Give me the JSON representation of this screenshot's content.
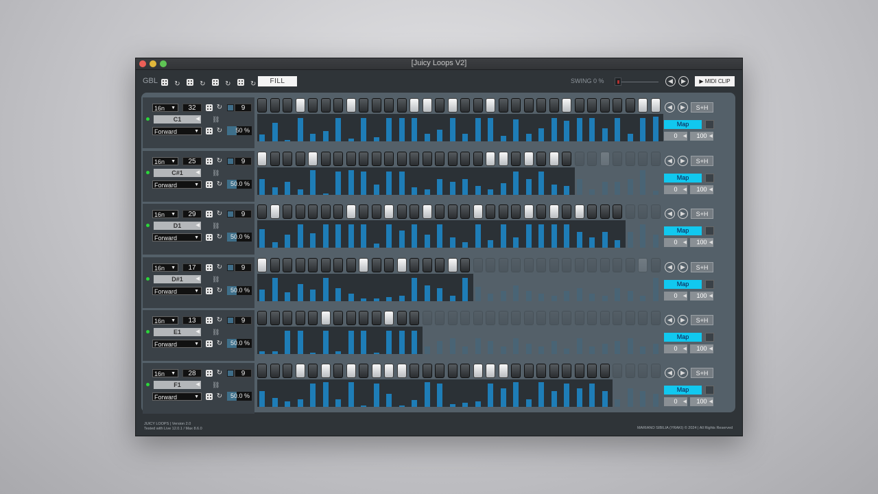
{
  "window": {
    "title": "[Juicy Loops V2]"
  },
  "toolbar": {
    "gbl_label": "GBL",
    "fill_label": "FILL",
    "swing_label": "SWING 0 %",
    "swing_value": 0,
    "midi_clip_label": "MIDI CLIP",
    "prev_icon": "arrow-left-circle-icon",
    "next_icon": "arrow-right-circle-icon"
  },
  "colors": {
    "accent": "#11c8ef",
    "velocity_bar": "#1e7db7",
    "step_on": "#f2f2f2",
    "status_dot": "#2bd63a"
  },
  "tracks": [
    {
      "rate": "16n",
      "length": "32",
      "amount": "9",
      "note": "C1",
      "direction": "Forward",
      "probability": "50 %",
      "steps": [
        0,
        0,
        0,
        1,
        0,
        0,
        0,
        1,
        0,
        0,
        0,
        0,
        1,
        1,
        0,
        1,
        0,
        0,
        1,
        0,
        0,
        0,
        0,
        0,
        1,
        0,
        0,
        0,
        0,
        0,
        1,
        1
      ],
      "velocity": [
        0.25,
        0.7,
        0.05,
        0.9,
        0.3,
        0.4,
        0.9,
        0.1,
        0.9,
        0.15,
        0.9,
        0.9,
        0.9,
        0.3,
        0.45,
        0.9,
        0.3,
        0.9,
        0.9,
        0.2,
        0.85,
        0.3,
        0.5,
        0.9,
        0.8,
        0.9,
        0.9,
        0.5,
        0.9,
        0.3,
        0.9,
        0.95
      ],
      "sh_label": "S+H",
      "map_label": "Map",
      "range_min": "0",
      "range_max": "100"
    },
    {
      "rate": "16n",
      "length": "25",
      "amount": "9",
      "note": "C#1",
      "direction": "Forward",
      "probability": "50.0 %",
      "steps": [
        1,
        0,
        0,
        0,
        1,
        0,
        0,
        0,
        0,
        0,
        0,
        0,
        0,
        0,
        0,
        0,
        0,
        0,
        1,
        1,
        0,
        1,
        0,
        1,
        0,
        0,
        0,
        1,
        0,
        0,
        0,
        0
      ],
      "velocity": [
        0.6,
        0.3,
        0.5,
        0.2,
        0.95,
        0.05,
        0.9,
        0.95,
        0.9,
        0.4,
        0.9,
        0.9,
        0.3,
        0.2,
        0.6,
        0.5,
        0.6,
        0.35,
        0.2,
        0.45,
        0.9,
        0.6,
        0.9,
        0.4,
        0.35,
        0.6,
        0.2,
        0.5,
        0.5,
        0.6,
        0.95,
        0.15
      ],
      "sh_label": "S+H",
      "map_label": "Map",
      "range_min": "0",
      "range_max": "100"
    },
    {
      "rate": "16n",
      "length": "29",
      "amount": "9",
      "note": "D1",
      "direction": "Forward",
      "probability": "50.0 %",
      "steps": [
        0,
        1,
        0,
        0,
        0,
        0,
        0,
        1,
        0,
        0,
        1,
        0,
        0,
        1,
        0,
        0,
        0,
        1,
        0,
        0,
        0,
        1,
        0,
        1,
        0,
        1,
        0,
        0,
        0,
        0,
        0,
        0
      ],
      "velocity": [
        0.7,
        0.2,
        0.5,
        0.9,
        0.55,
        0.9,
        0.9,
        0.9,
        0.9,
        0.15,
        0.9,
        0.65,
        0.9,
        0.5,
        0.9,
        0.4,
        0.2,
        0.9,
        0.3,
        0.9,
        0.4,
        0.9,
        0.9,
        0.9,
        0.9,
        0.6,
        0.4,
        0.6,
        0.3,
        0.6,
        0.9,
        0.5
      ],
      "sh_label": "S+H",
      "map_label": "Map",
      "range_min": "0",
      "range_max": "100"
    },
    {
      "rate": "16n",
      "length": "17",
      "amount": "9",
      "note": "D#1",
      "direction": "Forward",
      "probability": "50.0 %",
      "steps": [
        1,
        0,
        0,
        0,
        0,
        0,
        0,
        0,
        1,
        0,
        0,
        1,
        0,
        0,
        0,
        1,
        0,
        0,
        0,
        0,
        0,
        0,
        0,
        0,
        0,
        0,
        0,
        0,
        0,
        0,
        1,
        0
      ],
      "velocity": [
        0.45,
        0.9,
        0.35,
        0.65,
        0.45,
        0.9,
        0.5,
        0.3,
        0.1,
        0.1,
        0.15,
        0.2,
        0.9,
        0.6,
        0.5,
        0.2,
        0.9,
        0.55,
        0.3,
        0.4,
        0.6,
        0.4,
        0.3,
        0.2,
        0.4,
        0.5,
        0.3,
        0.2,
        0.5,
        0.4,
        0.2,
        0.9
      ],
      "sh_label": "S+H",
      "map_label": "Map",
      "range_min": "0",
      "range_max": "100"
    },
    {
      "rate": "16n",
      "length": "13",
      "amount": "9",
      "note": "E1",
      "direction": "Forward",
      "probability": "50.0 %",
      "steps": [
        0,
        0,
        0,
        0,
        0,
        1,
        0,
        0,
        0,
        0,
        1,
        0,
        0,
        0,
        0,
        0,
        0,
        0,
        0,
        0,
        0,
        0,
        0,
        0,
        0,
        0,
        0,
        0,
        0,
        0,
        0,
        0
      ],
      "velocity": [
        0.1,
        0.1,
        0.9,
        0.9,
        0.05,
        0.9,
        0.1,
        0.9,
        0.9,
        0.05,
        0.9,
        0.9,
        0.9,
        0.3,
        0.5,
        0.6,
        0.3,
        0.6,
        0.5,
        0.3,
        0.6,
        0.4,
        0.3,
        0.5,
        0.2,
        0.6,
        0.3,
        0.4,
        0.5,
        0.6,
        0.3,
        0.4
      ],
      "sh_label": "S+H",
      "map_label": "Map",
      "range_min": "0",
      "range_max": "100"
    },
    {
      "rate": "16n",
      "length": "28",
      "amount": "9",
      "note": "F1",
      "direction": "Forward",
      "probability": "50.0 %",
      "steps": [
        0,
        0,
        0,
        1,
        0,
        1,
        0,
        1,
        0,
        1,
        1,
        1,
        0,
        0,
        0,
        0,
        0,
        1,
        1,
        1,
        0,
        0,
        0,
        0,
        0,
        0,
        0,
        0,
        0,
        0,
        0,
        0
      ],
      "velocity": [
        0.6,
        0.35,
        0.2,
        0.3,
        0.9,
        0.95,
        0.3,
        0.95,
        0.05,
        0.9,
        0.5,
        0.05,
        0.25,
        0.95,
        0.9,
        0.1,
        0.15,
        0.2,
        0.9,
        0.7,
        0.95,
        0.3,
        0.95,
        0.6,
        0.9,
        0.7,
        0.9,
        0.6,
        0.3,
        0.7,
        0.6,
        0.5
      ],
      "sh_label": "S+H",
      "map_label": "Map",
      "range_min": "0",
      "range_max": "100"
    }
  ],
  "footer": {
    "left_line1": "JUICY LOOPS | Version 2.0",
    "left_line2": "Tested with Live 12.0.1 / Max 8.6.0",
    "right": "MARIANO SIBILIA (YRAKI) © 2024 | All Rights Reserved"
  }
}
